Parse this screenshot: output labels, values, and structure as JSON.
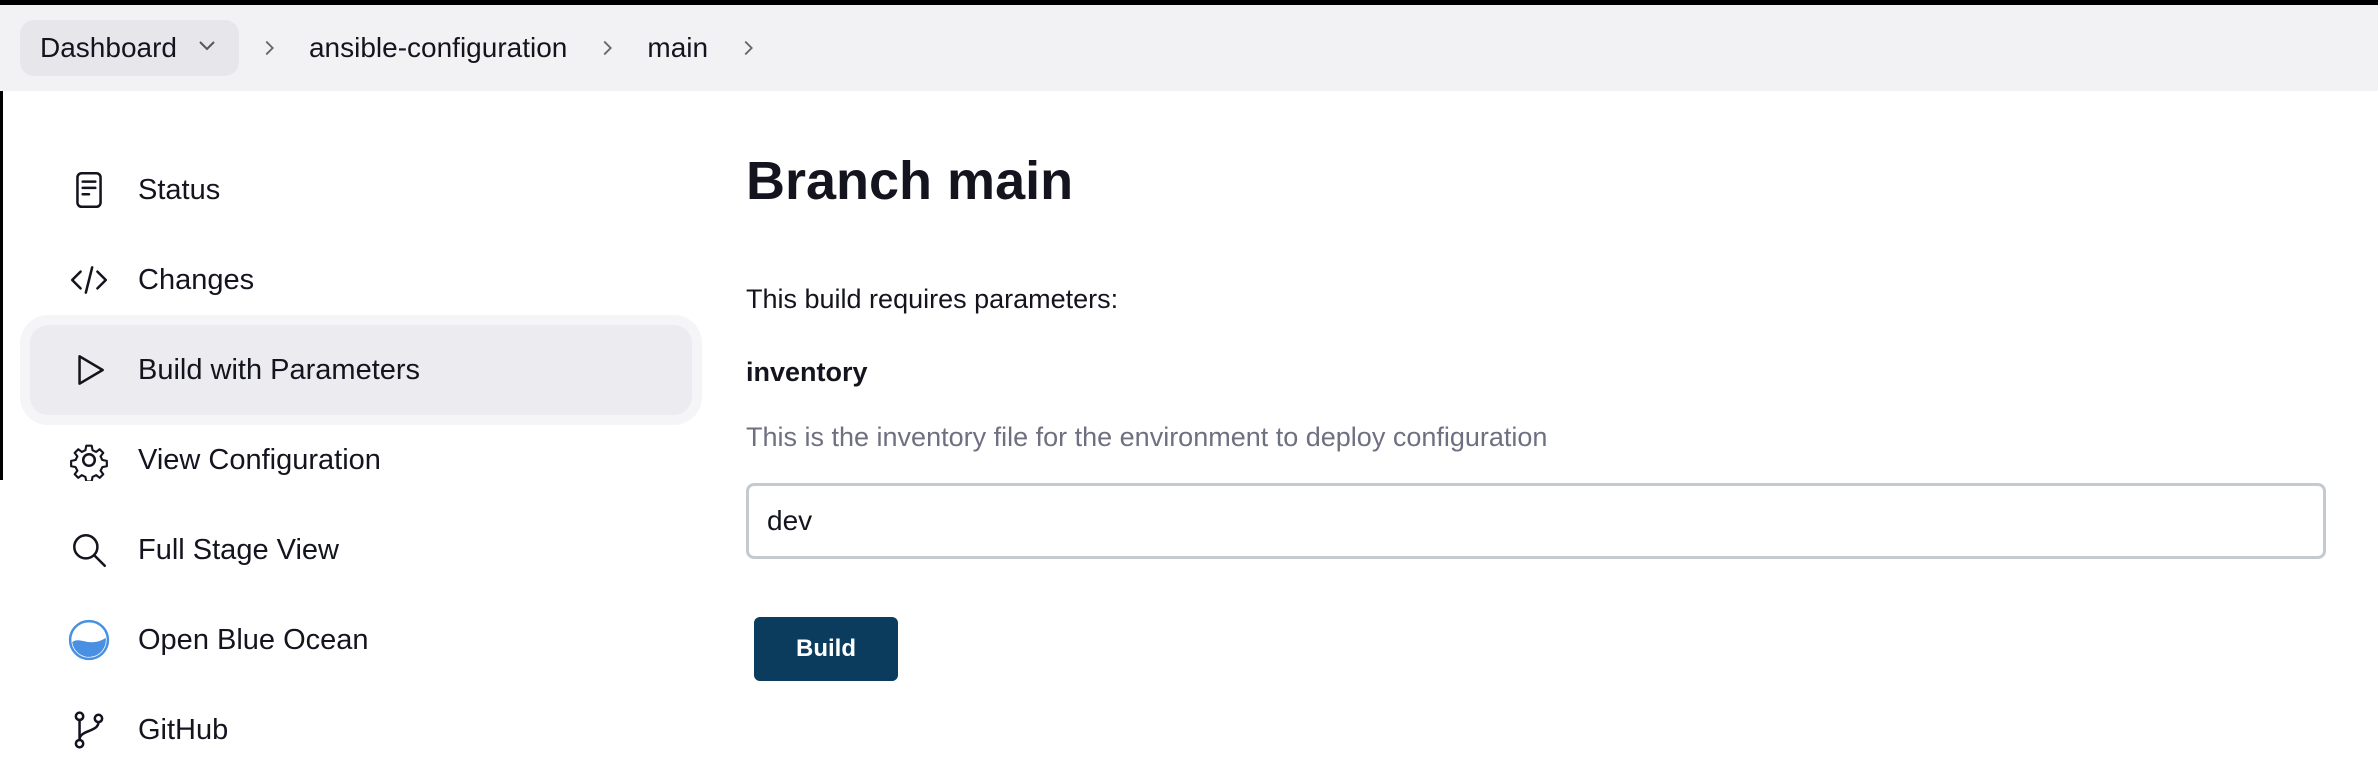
{
  "breadcrumb": {
    "items": [
      {
        "label": "Dashboard"
      },
      {
        "label": "ansible-configuration"
      },
      {
        "label": "main"
      }
    ]
  },
  "sidebar": {
    "items": [
      {
        "label": "Status",
        "icon": "document-icon"
      },
      {
        "label": "Changes",
        "icon": "code-icon"
      },
      {
        "label": "Build with Parameters",
        "icon": "play-icon",
        "active": true
      },
      {
        "label": "View Configuration",
        "icon": "gear-icon"
      },
      {
        "label": "Full Stage View",
        "icon": "search-icon"
      },
      {
        "label": "Open Blue Ocean",
        "icon": "blue-ocean-icon"
      },
      {
        "label": "GitHub",
        "icon": "git-branch-icon"
      }
    ]
  },
  "main": {
    "title": "Branch main",
    "requires_text": "This build requires parameters:",
    "parameter": {
      "name": "inventory",
      "description": "This is the inventory file for the environment to deploy configuration",
      "value": "dev"
    },
    "build_label": "Build"
  },
  "colors": {
    "accent": "#0b3c5d",
    "breadcrumb_bg": "#f2f2f4",
    "active_item_bg": "#ececf0",
    "muted_text": "#6f6f82",
    "blue_ocean": "#4a90e2"
  }
}
